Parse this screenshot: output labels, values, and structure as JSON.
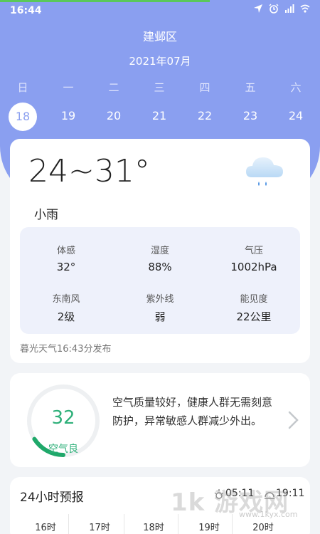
{
  "status_bar": {
    "time": "16:44",
    "icons": [
      "location-icon",
      "alarm-icon",
      "hd-signal-icon",
      "wifi-icon"
    ]
  },
  "header": {
    "district": "建邺区",
    "month": "2021年07月",
    "weekdays": [
      "日",
      "一",
      "二",
      "三",
      "四",
      "五",
      "六"
    ],
    "dates": [
      "18",
      "19",
      "20",
      "21",
      "22",
      "23",
      "24"
    ],
    "selected_date": "18"
  },
  "today": {
    "temperature_range": "24~31°",
    "condition": "小雨",
    "weather_icon": "rain-cloud-icon",
    "details": [
      {
        "label": "体感",
        "value": "32°"
      },
      {
        "label": "湿度",
        "value": "88%"
      },
      {
        "label": "气压",
        "value": "1002hPa"
      },
      {
        "label": "东南风",
        "value": "2级"
      },
      {
        "label": "紫外线",
        "value": "弱"
      },
      {
        "label": "能见度",
        "value": "22公里"
      }
    ],
    "publish_note": "暮光天气16:43分发布"
  },
  "air_quality": {
    "value": "32",
    "level": "空气良",
    "description": "空气质量较好，健康人群无需刻意防护，异常敏感人群减少外出。",
    "ring_fraction": 0.16
  },
  "forecast": {
    "title": "24小时预报",
    "sunrise": "05:11",
    "sunset": "19:11",
    "hours": [
      "16时",
      "17时",
      "18时",
      "19时",
      "20时"
    ]
  },
  "watermark": {
    "text": "1k 游戏网",
    "url": "www.1kyx.com"
  },
  "colors": {
    "header_blue": "#8a9ff0",
    "aqi_green": "#2fb07a"
  }
}
